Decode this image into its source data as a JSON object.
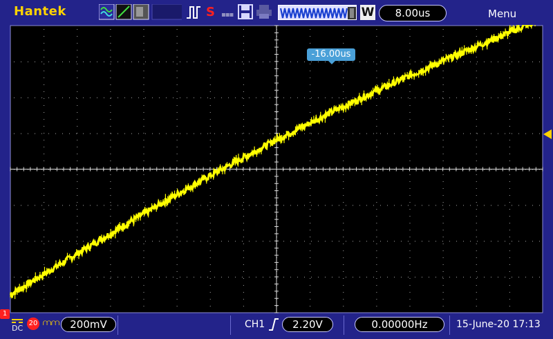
{
  "header": {
    "brand": "Hantek",
    "run_indicator": "S",
    "timebase": "8.00us",
    "menu": "Menu",
    "w_label": "W"
  },
  "screen": {
    "trigger_position": "-16.00us",
    "grid": {
      "h_divisions": 10,
      "v_divisions": 8
    },
    "trace_color": "#ffff00",
    "trace": {
      "description_type": "line",
      "x_div": [
        -8.0,
        8.0
      ],
      "y_div": [
        -3.5,
        4.2
      ]
    }
  },
  "footer": {
    "coupling": "DC",
    "bw_limit": "20",
    "volts_per_div": "200mV",
    "trigger_source": "CH1",
    "trigger_level": "2.20V",
    "frequency": "0.00000Hz",
    "datetime": "15-June-20 17:13",
    "channel_marker": "1"
  },
  "colors": {
    "background": "#23238a",
    "brand": "#ffd200",
    "accent_blue": "#4aa0d8",
    "run_red": "#ff2020",
    "trigger_marker": "#ffd200"
  }
}
